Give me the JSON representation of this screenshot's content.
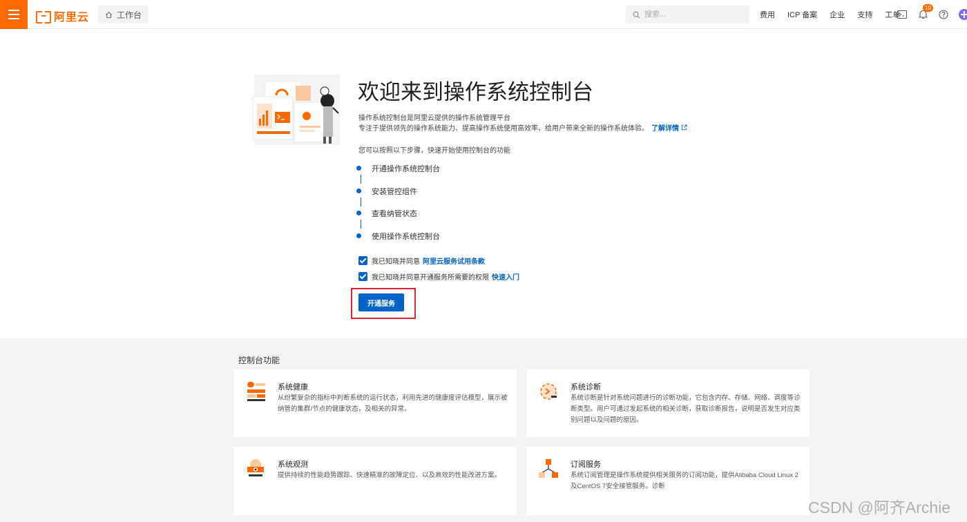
{
  "topbar": {
    "logo_text": "阿里云",
    "workbench_label": "工作台",
    "search_placeholder": "搜索...",
    "links": [
      "费用",
      "ICP 备案",
      "企业",
      "支持",
      "工单"
    ],
    "notification_count": "10"
  },
  "hero": {
    "title": "欢迎来到操作系统控制台",
    "desc_line1": "操作系统控制台是阿里云提供的操作系统管理平台",
    "desc_line2": "专注于提供领先的操作系统能力、提高操作系统使用高效率、给用户带来全新的操作系统体验。",
    "learn_more": "了解详情",
    "steps_intro": "您可以按照以下步骤，快速开始使用控制台的功能",
    "steps": [
      "开通操作系统控制台",
      "安装管控组件",
      "查看纳管状态",
      "使用操作系统控制台"
    ],
    "agree1_text": "我已知晓并同意",
    "agree1_link": "阿里云服务试用条款",
    "agree2_text": "我已知晓并同意开通服务所需要的权限",
    "agree2_link": "快速入门",
    "open_button": "开通服务"
  },
  "features": {
    "title": "控制台功能",
    "cards": [
      {
        "title": "系统健康",
        "desc": "从纷繁复杂的指标中判断系统的运行状态，利用先进的健康度评估模型，展示被纳管的集群/节点的健康状态，及相关的异常。",
        "icon": "health-icon"
      },
      {
        "title": "系统诊断",
        "desc": "系统诊断是针对系统问题进行的诊断功能，它包含内存、存储、网络、调度等诊断类型。用户可通过发起系统的相关诊断，获取诊断报告，说明是否发生对应类别问题以及问题的原因。",
        "icon": "diagnosis-icon"
      },
      {
        "title": "系统观测",
        "desc": "提供持续的性能趋势跟踪、快速精准的故障定位、以及高效的性能改进方案。",
        "icon": "observe-icon"
      },
      {
        "title": "订阅服务",
        "desc": "系统订阅管理是操作系统提供相关服务的订阅功能，提供Alibaba Cloud Linux 2及CentOS 7安全接管服务。诊断",
        "icon": "subscribe-icon"
      }
    ]
  },
  "watermark": "CSDN @阿齐Archie",
  "colors": {
    "brand": "#ff6a00",
    "primary": "#0064c8",
    "highlight": "#d9252b"
  }
}
